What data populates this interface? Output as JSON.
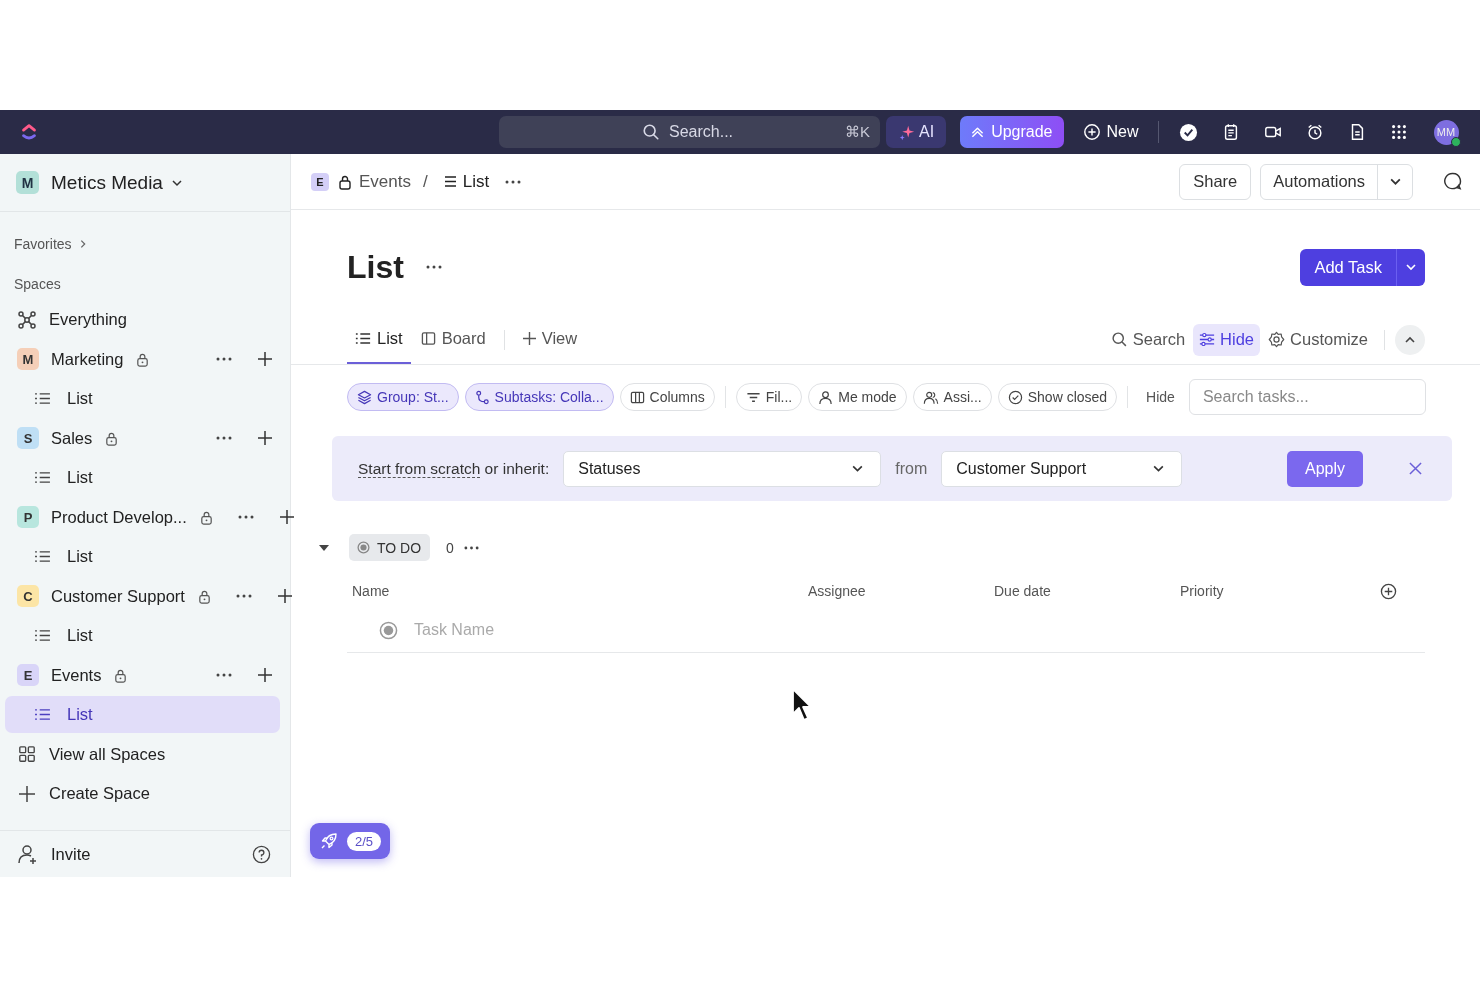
{
  "topbar": {
    "search": {
      "placeholder": "Search...",
      "shortcut": "⌘K"
    },
    "ai": "AI",
    "upgrade": "Upgrade",
    "new": "New",
    "avatar": "MM"
  },
  "sidebar": {
    "workspace": {
      "initial": "M",
      "name": "Metics Media"
    },
    "favorites": "Favorites",
    "spaces_label": "Spaces",
    "everything": "Everything",
    "spaces": [
      {
        "initial": "M",
        "name": "Marketing",
        "color": "#f5cfb8",
        "children": [
          {
            "label": "List",
            "selected": false
          }
        ]
      },
      {
        "initial": "S",
        "name": "Sales",
        "color": "#bfdff5",
        "children": [
          {
            "label": "List",
            "selected": false
          }
        ]
      },
      {
        "initial": "P",
        "name": "Product Develop...",
        "color": "#b8e6de",
        "children": [
          {
            "label": "List",
            "selected": false
          }
        ]
      },
      {
        "initial": "C",
        "name": "Customer Support",
        "color": "#fce5a6",
        "children": [
          {
            "label": "List",
            "selected": false
          }
        ]
      },
      {
        "initial": "E",
        "name": "Events",
        "color": "#d9d5f8",
        "children": [
          {
            "label": "List",
            "selected": true
          }
        ]
      }
    ],
    "view_all": "View all Spaces",
    "create": "Create Space",
    "invite": "Invite"
  },
  "breadcrumb": {
    "space_initial": "E",
    "space": "Events",
    "separator": "/",
    "list": "List"
  },
  "header_buttons": {
    "share": "Share",
    "automations": "Automations"
  },
  "title": "List",
  "add_task": "Add Task",
  "views": [
    {
      "label": "List",
      "selected": true
    },
    {
      "label": "Board",
      "selected": false
    }
  ],
  "add_view": "View",
  "view_tools": [
    {
      "label": "Search",
      "selected": false
    },
    {
      "label": "Hide",
      "selected": true
    },
    {
      "label": "Customize",
      "selected": false
    }
  ],
  "filters": [
    {
      "label": "Group: St...",
      "active": true
    },
    {
      "label": "Subtasks: Colla...",
      "active": true
    },
    {
      "label": "Columns",
      "active": false
    },
    {
      "label": "Fil...",
      "active": false
    },
    {
      "label": "Me mode",
      "active": false
    },
    {
      "label": "Assi...",
      "active": false
    },
    {
      "label": "Show closed",
      "active": false
    }
  ],
  "hide_label": "Hide",
  "task_search": {
    "placeholder": "Search tasks..."
  },
  "banner": {
    "link": "Start from scratch",
    "text": " or inherit:",
    "template": "Statuses",
    "from": "from",
    "source": "Customer Support",
    "apply": "Apply"
  },
  "group": {
    "status": "TO DO",
    "count": "0",
    "expanded": true,
    "columns": [
      "Name",
      "Assignee",
      "Due date",
      "Priority"
    ],
    "new_task": {
      "placeholder": "Task Name"
    }
  },
  "onboarding": {
    "progress": "2/5"
  }
}
